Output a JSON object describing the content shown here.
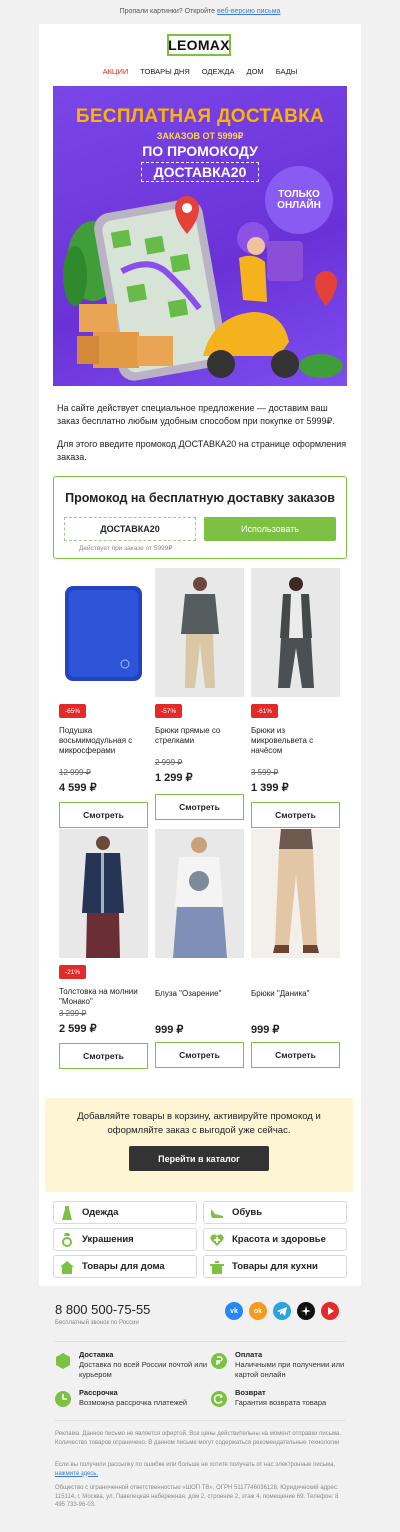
{
  "preheader": {
    "text": "Пропали картинки? Откройте",
    "link": "веб-версию письма"
  },
  "logo": "LEOMAX",
  "nav": [
    "АКЦИИ",
    "ТОВАРЫ ДНЯ",
    "ОДЕЖДА",
    "ДОМ",
    "БАДЫ"
  ],
  "hero": {
    "title": "БЕСПЛАТНАЯ ДОСТАВКА",
    "sub": "ЗАКАЗОВ ОТ 5999₽",
    "promo_label": "ПО ПРОМОКОДУ",
    "code": "ДОСТАВКА20",
    "badge": "ТОЛЬКО ОНЛАЙН"
  },
  "intro": {
    "p1": "На сайте действует специальное предложение — доставим ваш заказ бесплатно любым удобным способом при покупке от 5999₽.",
    "p2": "Для этого введите промокод ДОСТАВКА20 на странице оформления заказа."
  },
  "promo": {
    "title": "Промокод на бесплатную доставку заказов",
    "code": "ДОСТАВКА20",
    "button": "Использовать",
    "note": "Действует при заказе от 5999₽"
  },
  "products": [
    {
      "discount": "-65%",
      "name": "Подушка восьмимодульная с микросферами",
      "old": "12 999 ₽",
      "price": "4 599 ₽",
      "button": "Смотреть"
    },
    {
      "discount": "-57%",
      "name": "Брюки прямые со стрелками",
      "old": "2 999 ₽",
      "price": "1 299 ₽",
      "button": "Смотреть"
    },
    {
      "discount": "-61%",
      "name": "Брюки из микровельвета с начёсом",
      "old": "3 599 ₽",
      "price": "1 399 ₽",
      "button": "Смотреть"
    },
    {
      "discount": "-21%",
      "name": "Толстовка на молнии \"Монако\"",
      "old": "3 299 ₽",
      "price": "2 599 ₽",
      "button": "Смотреть"
    },
    {
      "discount": "",
      "name": "Блуза \"Озарение\"",
      "old": "",
      "price": "999 ₽",
      "button": "Смотреть"
    },
    {
      "discount": "",
      "name": "Брюки \"Даника\"",
      "old": "",
      "price": "999 ₽",
      "button": "Смотреть"
    }
  ],
  "cta": {
    "text": "Добавляйте товары в корзину, активируйте промокод и оформляйте заказ с выгодой уже сейчас.",
    "button": "Перейти в каталог"
  },
  "categories": [
    {
      "label": "Одежда",
      "icon": "dress-icon"
    },
    {
      "label": "Обувь",
      "icon": "shoe-icon"
    },
    {
      "label": "Украшения",
      "icon": "ring-icon"
    },
    {
      "label": "Красота и здоровье",
      "icon": "health-icon"
    },
    {
      "label": "Товары для дома",
      "icon": "house-icon"
    },
    {
      "label": "Товары для кухни",
      "icon": "pot-icon"
    }
  ],
  "footer": {
    "phone": "8 800 500-75-55",
    "phone_note": "Бесплатный звонок по России",
    "socials": [
      "vk-icon",
      "ok-icon",
      "telegram-icon",
      "star-icon",
      "youtube-icon"
    ],
    "features": [
      {
        "title": "Доставка",
        "desc": "Доставка по всей России почтой или курьером",
        "icon": "box-icon"
      },
      {
        "title": "Оплата",
        "desc": "Наличными при получении или картой онлайн",
        "icon": "ruble-icon"
      },
      {
        "title": "Рассрочка",
        "desc": "Возможна рассрочка платежей",
        "icon": "clock-icon"
      },
      {
        "title": "Возврат",
        "desc": "Гарантия возврата товара",
        "icon": "return-icon"
      }
    ],
    "legal1": "Реклама. Данное письмо не является офертой. Все цены действительны на момент отправки письма. Количество товаров ограничено. В данном письме могут содержаться рекомендательные технологии",
    "legal2": "Если вы получили рассылку по ошибке или больше не хотите получать от нас электронные письма,",
    "legal2_link": "нажмите здесь.",
    "legal3": "Общество с ограниченной ответственностью «ШОП ТВ», ОГРН 5117746036128, Юридический адрес: 115114, г. Москва, ул. Павелецкая набережная, дом 2, строение 2, этаж 4, помещение 69. Телефон: 8 495 733-96-03."
  }
}
